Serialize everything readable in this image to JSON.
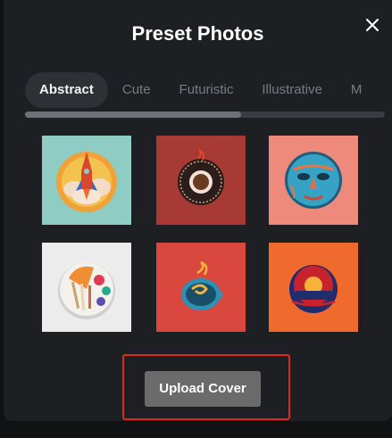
{
  "modal": {
    "title": "Preset Photos",
    "close_icon": "close-icon"
  },
  "tabs": [
    {
      "label": "Abstract",
      "active": true
    },
    {
      "label": "Cute",
      "active": false
    },
    {
      "label": "Futuristic",
      "active": false
    },
    {
      "label": "Illustrative",
      "active": false
    },
    {
      "label": "M",
      "active": false
    }
  ],
  "scrollbar": {
    "position_fraction": 0.6
  },
  "photos": [
    {
      "name": "rocket-clouds-photo",
      "background": "#8fcdc4"
    },
    {
      "name": "coffee-cup-photo",
      "background": "#a83a36"
    },
    {
      "name": "blue-mask-face-photo",
      "background": "#ee8a7c"
    },
    {
      "name": "palette-brushes-photo",
      "background": "#ececec"
    },
    {
      "name": "teacup-swirl-photo",
      "background": "#d9473f"
    },
    {
      "name": "sunset-badge-photo",
      "background": "#f06a2e"
    }
  ],
  "upload_button": {
    "label": "Upload Cover"
  },
  "colors": {
    "modal_bg": "#1e1f22",
    "highlight_border": "#e0271a",
    "button_bg": "#6b6b6b"
  }
}
